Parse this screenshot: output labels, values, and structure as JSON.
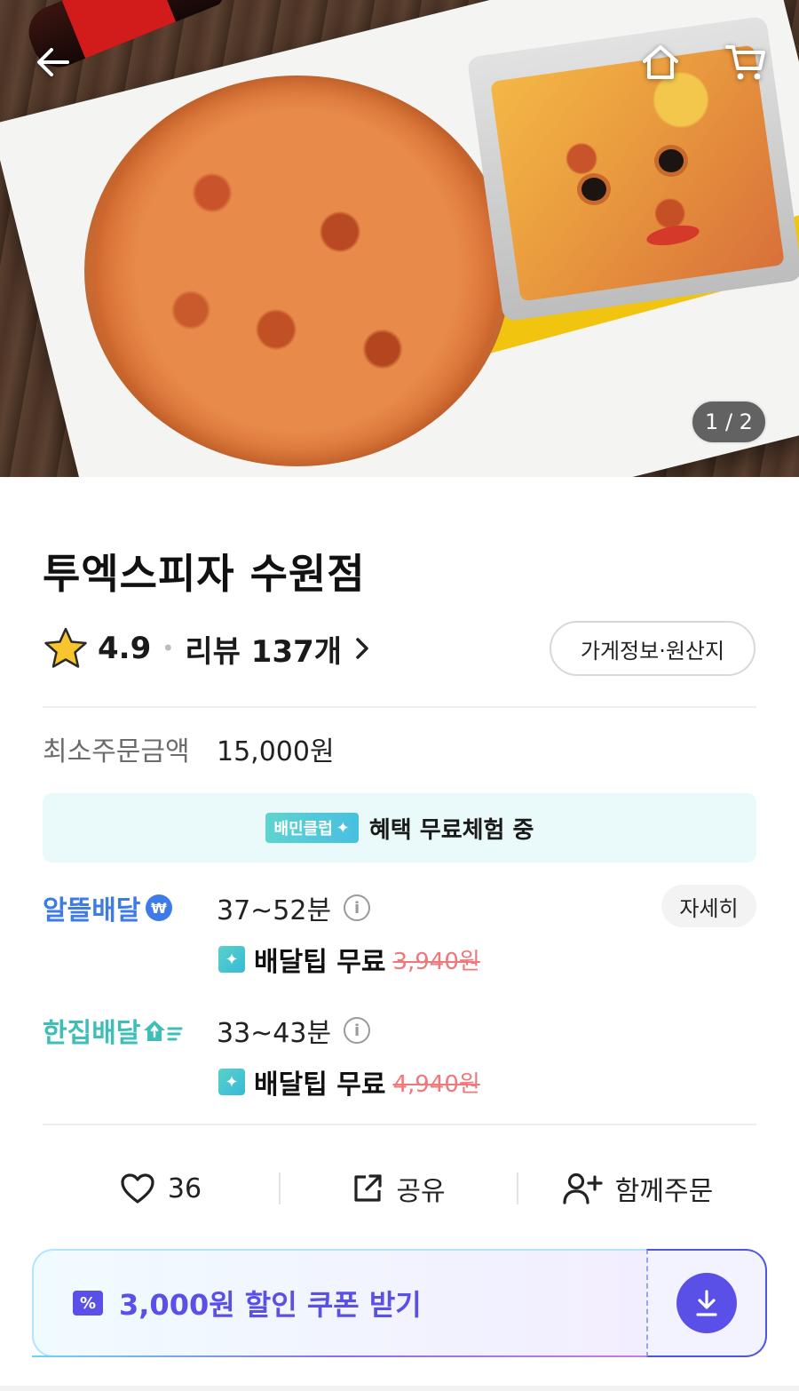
{
  "hero": {
    "page_counter": "1 / 2",
    "icons": [
      "back-arrow-icon",
      "home-icon",
      "cart-icon"
    ]
  },
  "store": {
    "name": "투엑스피자 수원점",
    "rating": "4.9",
    "reviews": "리뷰 137개",
    "info_button": "가게정보·원산지"
  },
  "min_order": {
    "label": "최소주문금액",
    "value": "15,000원"
  },
  "club": {
    "tag": "배민클럽",
    "text": "혜택 무료체험 중"
  },
  "delivery": [
    {
      "name": "알뜰배달",
      "color": "#3e7be6",
      "time": "37~52분",
      "tip_label": "배달팁 무료",
      "tip_original": "3,940원"
    },
    {
      "name": "한집배달",
      "color": "#3dbfb8",
      "time": "33~43분",
      "tip_label": "배달팁 무료",
      "tip_original": "4,940원"
    }
  ],
  "detail_button": "자세히",
  "actions": {
    "likes": "36",
    "share": "공유",
    "group_order": "함께주문"
  },
  "coupon": {
    "text": "3,000원 할인 쿠폰 받기",
    "accent": "#5a4fe6"
  }
}
